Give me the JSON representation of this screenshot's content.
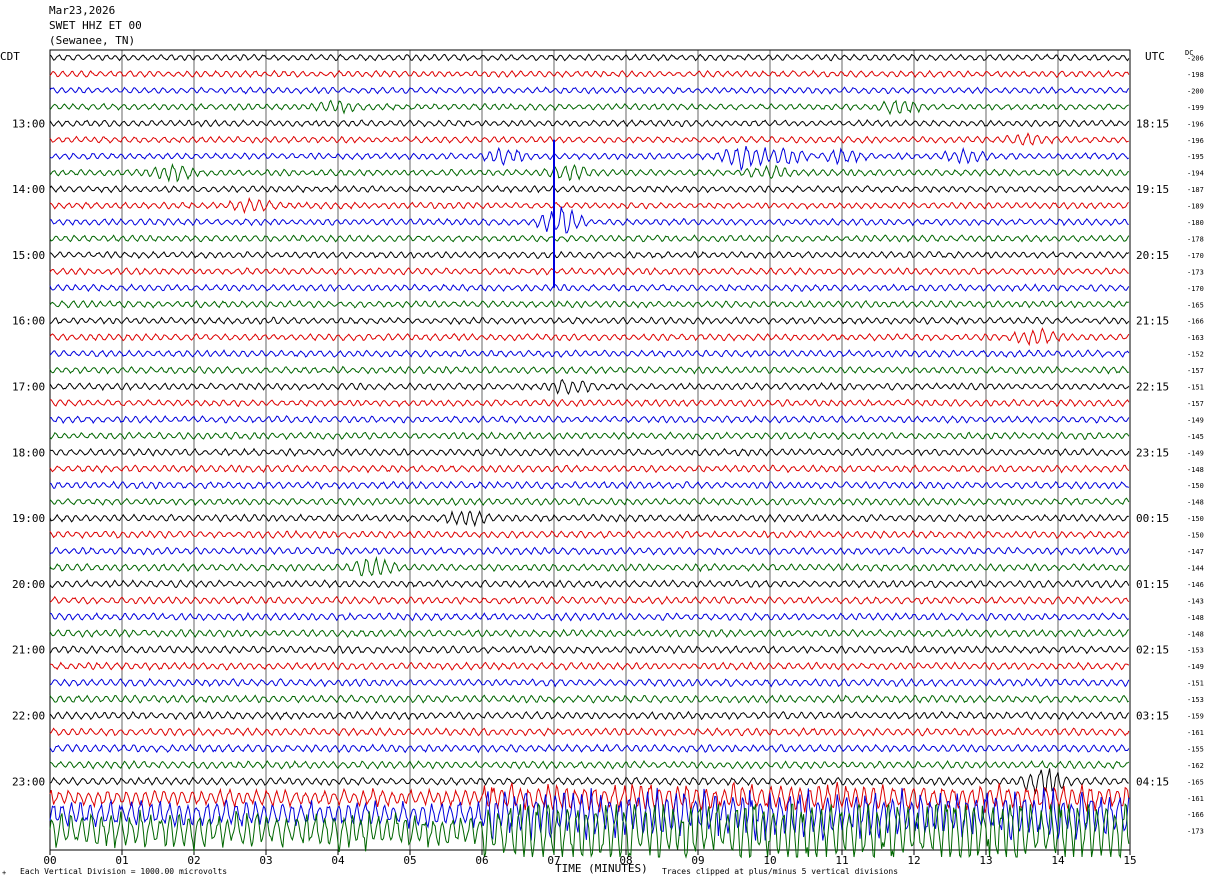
{
  "header": {
    "date": "Mar23,2026",
    "station": "SWET HHZ ET 00",
    "location": "(Sewanee, TN)"
  },
  "labels": {
    "left_timezone": "CDT",
    "right_timezone": "UTC",
    "dc_header": "DC",
    "x_axis_title": "TIME (MINUTES)",
    "note_left": "Each Vertical Division = 1000.00 microvolts",
    "note_right": "Traces clipped at plus/minus 5 vertical divisions",
    "mark": "+"
  },
  "colors": {
    "trace_cycle": [
      "#000000",
      "#dd0000",
      "#0000dd",
      "#006600"
    ],
    "grid": "#000000",
    "background": "#ffffff"
  },
  "chart_data": {
    "type": "line",
    "description_type": "helicorder",
    "x_range_minutes": [
      0,
      15
    ],
    "x_ticks": [
      "00",
      "01",
      "02",
      "03",
      "04",
      "05",
      "06",
      "07",
      "08",
      "09",
      "10",
      "11",
      "12",
      "13",
      "14",
      "15"
    ],
    "left_hour_labels": [
      "13:00",
      "14:00",
      "15:00",
      "16:00",
      "17:00",
      "18:00",
      "19:00",
      "20:00",
      "21:00",
      "22:00",
      "23:00"
    ],
    "left_hour_first_row": 4,
    "right_hour_labels": [
      "18:15",
      "19:15",
      "20:15",
      "21:15",
      "22:15",
      "23:15",
      "00:15",
      "01:15",
      "02:15",
      "03:15",
      "04:15"
    ],
    "row_count": 48,
    "rows_per_hour": 4,
    "dc_offsets": [
      -206,
      -198,
      -200,
      -199,
      -196,
      -196,
      -195,
      -194,
      -187,
      -189,
      -180,
      -178,
      -170,
      -173,
      -170,
      -165,
      -166,
      -163,
      -152,
      -157,
      -151,
      -157,
      -149,
      -145,
      -149,
      -148,
      -150,
      -148,
      -150,
      -150,
      -147,
      -144,
      -146,
      -143,
      -148,
      -148,
      -153,
      -149,
      -151,
      -153,
      -159,
      -161,
      -155,
      -162,
      -165,
      -161,
      -166,
      -173
    ],
    "events": [
      {
        "row": 3,
        "minute": 4.0,
        "amplitude": 1.5
      },
      {
        "row": 3,
        "minute": 11.8,
        "amplitude": 2.2
      },
      {
        "row": 5,
        "minute": 13.6,
        "amplitude": 1.4
      },
      {
        "row": 6,
        "minute": 6.3,
        "amplitude": 2.0
      },
      {
        "row": 6,
        "minute": 9.6,
        "amplitude": 3.2
      },
      {
        "row": 6,
        "minute": 10.2,
        "amplitude": 2.2
      },
      {
        "row": 6,
        "minute": 11.0,
        "amplitude": 1.8
      },
      {
        "row": 6,
        "minute": 12.7,
        "amplitude": 1.6
      },
      {
        "row": 7,
        "minute": 1.7,
        "amplitude": 2.4
      },
      {
        "row": 7,
        "minute": 7.2,
        "amplitude": 2.0
      },
      {
        "row": 7,
        "minute": 10.0,
        "amplitude": 1.5
      },
      {
        "row": 9,
        "minute": 2.8,
        "amplitude": 1.6
      },
      {
        "row": 10,
        "minute": 7.1,
        "amplitude": 4.0
      },
      {
        "row": 17,
        "minute": 13.7,
        "amplitude": 2.0
      },
      {
        "row": 20,
        "minute": 7.2,
        "amplitude": 1.8
      },
      {
        "row": 28,
        "minute": 5.8,
        "amplitude": 1.6
      },
      {
        "row": 31,
        "minute": 4.5,
        "amplitude": 2.6
      },
      {
        "row": 44,
        "minute": 13.8,
        "amplitude": 3.5
      }
    ],
    "spike": {
      "row_start": 5,
      "row_end": 14,
      "minute": 7.0
    },
    "clip_divisions": 5
  }
}
